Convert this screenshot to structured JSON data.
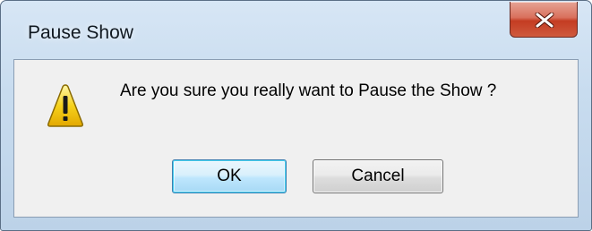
{
  "window": {
    "title": "Pause Show",
    "close_icon": "close-x-icon"
  },
  "content": {
    "icon": "warning-triangle-icon",
    "message": "Are you sure you really want to Pause the Show ?"
  },
  "buttons": {
    "ok_label": "OK",
    "cancel_label": "Cancel"
  },
  "colors": {
    "frame": "#c8dcef",
    "close_button": "#c43c22",
    "client_background": "#f0f0f0",
    "default_button": "#bee6fd"
  }
}
